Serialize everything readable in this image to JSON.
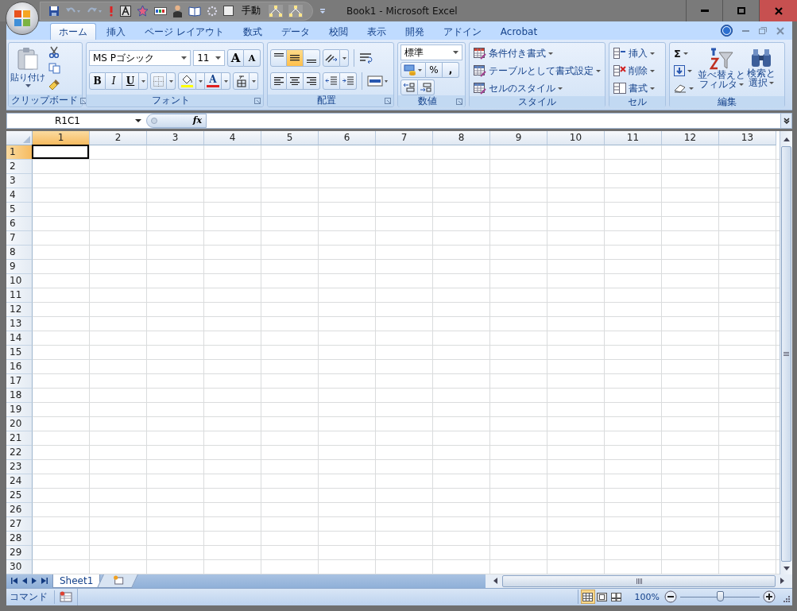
{
  "window": {
    "title": "Book1 - Microsoft Excel"
  },
  "quick_access": {
    "calc_mode": "手動"
  },
  "tabs": [
    {
      "label": "ホーム",
      "selected": true
    },
    {
      "label": "挿入",
      "selected": false
    },
    {
      "label": "ページ レイアウト",
      "selected": false
    },
    {
      "label": "数式",
      "selected": false
    },
    {
      "label": "データ",
      "selected": false
    },
    {
      "label": "校閲",
      "selected": false
    },
    {
      "label": "表示",
      "selected": false
    },
    {
      "label": "開発",
      "selected": false
    },
    {
      "label": "アドイン",
      "selected": false
    },
    {
      "label": "Acrobat",
      "selected": false
    }
  ],
  "clipboard": {
    "paste": "貼り付け",
    "group_label": "クリップボード"
  },
  "font": {
    "name": "MS Pゴシック",
    "size": "11",
    "grow": "A",
    "shrink": "A",
    "bold": "B",
    "italic": "I",
    "underline": "U",
    "font_color": "A",
    "group_label": "フォント"
  },
  "alignment": {
    "vertical": [
      {
        "kind": "top",
        "selected": false
      },
      {
        "kind": "middle",
        "selected": true
      },
      {
        "kind": "bottom",
        "selected": false
      }
    ],
    "horizontal": [
      {
        "kind": "left",
        "selected": false
      },
      {
        "kind": "center",
        "selected": false
      },
      {
        "kind": "right",
        "selected": false
      }
    ],
    "group_label": "配置"
  },
  "number": {
    "format": "標準",
    "percent": "%",
    "comma": ",",
    "group_label": "数値"
  },
  "styles": {
    "items": [
      "条件付き書式",
      "テーブルとして書式設定",
      "セルのスタイル"
    ],
    "group_label": "スタイル"
  },
  "cells": {
    "items": [
      "挿入",
      "削除",
      "書式"
    ],
    "group_label": "セル"
  },
  "editing": {
    "sum": "Σ",
    "sort": [
      "並べ替えと",
      "フィルタ"
    ],
    "find": [
      "検索と",
      "選択"
    ],
    "group_label": "編集"
  },
  "formula_bar": {
    "name_box": "R1C1",
    "function_label": "fx"
  },
  "sheet": {
    "columns": [
      {
        "label": "1",
        "selected": true
      },
      {
        "label": "2",
        "selected": false
      },
      {
        "label": "3",
        "selected": false
      },
      {
        "label": "4",
        "selected": false
      },
      {
        "label": "5",
        "selected": false
      },
      {
        "label": "6",
        "selected": false
      },
      {
        "label": "7",
        "selected": false
      },
      {
        "label": "8",
        "selected": false
      },
      {
        "label": "9",
        "selected": false
      },
      {
        "label": "10",
        "selected": false
      },
      {
        "label": "11",
        "selected": false
      },
      {
        "label": "12",
        "selected": false
      },
      {
        "label": "13",
        "selected": false
      }
    ],
    "rows": [
      {
        "label": "1",
        "selected": true
      },
      {
        "label": "2",
        "selected": false
      },
      {
        "label": "3",
        "selected": false
      },
      {
        "label": "4",
        "selected": false
      },
      {
        "label": "5",
        "selected": false
      },
      {
        "label": "6",
        "selected": false
      },
      {
        "label": "7",
        "selected": false
      },
      {
        "label": "8",
        "selected": false
      },
      {
        "label": "9",
        "selected": false
      },
      {
        "label": "10",
        "selected": false
      },
      {
        "label": "11",
        "selected": false
      },
      {
        "label": "12",
        "selected": false
      },
      {
        "label": "13",
        "selected": false
      },
      {
        "label": "14",
        "selected": false
      },
      {
        "label": "15",
        "selected": false
      },
      {
        "label": "16",
        "selected": false
      },
      {
        "label": "17",
        "selected": false
      },
      {
        "label": "18",
        "selected": false
      },
      {
        "label": "19",
        "selected": false
      },
      {
        "label": "20",
        "selected": false
      },
      {
        "label": "21",
        "selected": false
      },
      {
        "label": "22",
        "selected": false
      },
      {
        "label": "23",
        "selected": false
      },
      {
        "label": "24",
        "selected": false
      },
      {
        "label": "25",
        "selected": false
      },
      {
        "label": "26",
        "selected": false
      },
      {
        "label": "27",
        "selected": false
      },
      {
        "label": "28",
        "selected": false
      },
      {
        "label": "29",
        "selected": false
      },
      {
        "label": "30",
        "selected": false
      }
    ]
  },
  "sheet_tabs": [
    {
      "label": "Sheet1",
      "selected": true
    }
  ],
  "status_bar": {
    "mode": "コマンド",
    "views": [
      {
        "kind": "normal",
        "selected": true
      },
      {
        "kind": "page_layout",
        "selected": false
      },
      {
        "kind": "page_break",
        "selected": false
      }
    ],
    "zoom": "100%",
    "zoom_slider": {
      "level": 0.5
    }
  }
}
